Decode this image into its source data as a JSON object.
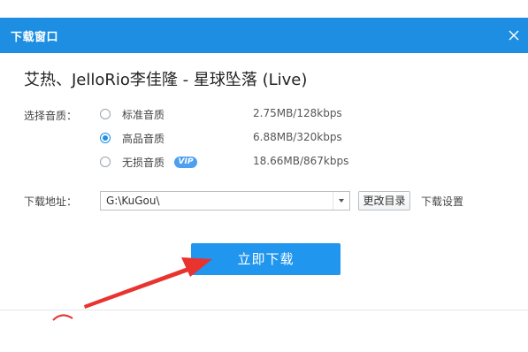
{
  "window": {
    "title": "下载窗口",
    "close_icon": "close-icon"
  },
  "song": {
    "title": "艾热、JelloRio李佳隆 - 星球坠落 (Live)"
  },
  "quality": {
    "label": "选择音质：",
    "options": [
      {
        "name": "标准音质",
        "size": "2.75MB/128kbps",
        "selected": false
      },
      {
        "name": "高品音质",
        "size": "6.88MB/320kbps",
        "selected": true
      },
      {
        "name": "无损音质",
        "size": "18.66MB/867kbps",
        "selected": false,
        "badge": "VIP"
      }
    ]
  },
  "location": {
    "label": "下载地址：",
    "path": "G:\\KuGou\\",
    "change_dir_label": "更改目录",
    "settings_label": "下载设置"
  },
  "actions": {
    "download_label": "立即下载"
  },
  "colors": {
    "accent": "#1e8ee2",
    "button": "#2196ee",
    "annotation": "#e8332f"
  }
}
